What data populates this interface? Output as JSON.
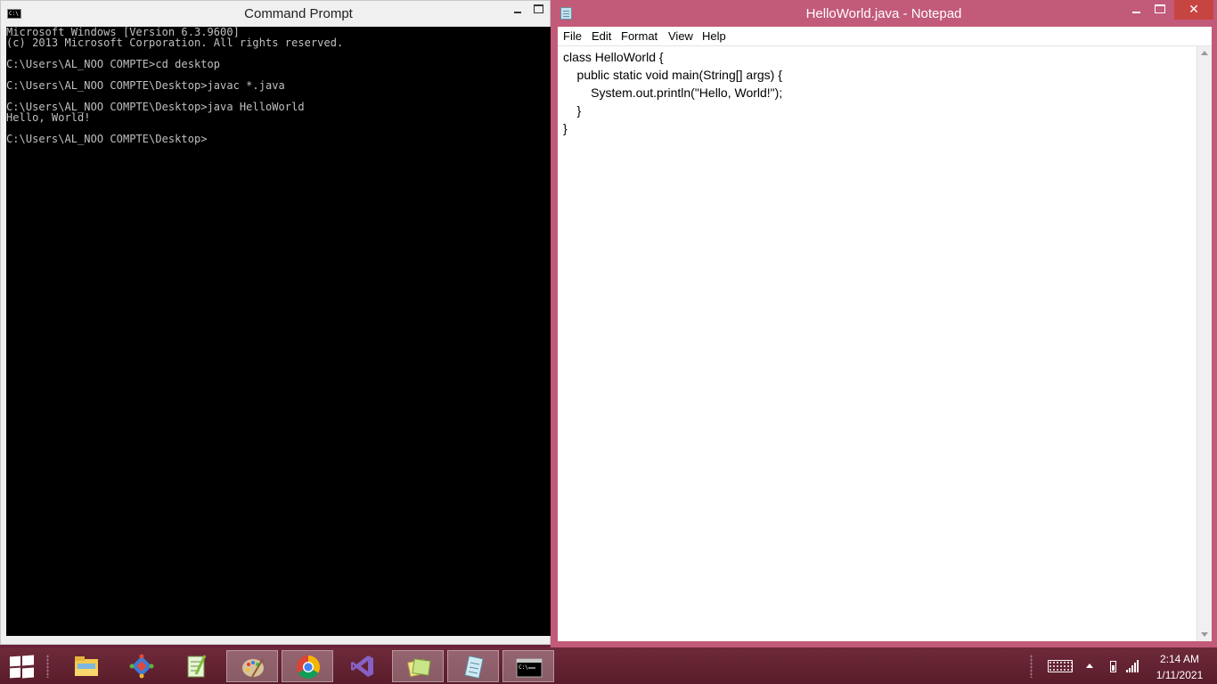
{
  "cmd": {
    "title": "Command Prompt",
    "lines": [
      "Microsoft Windows [Version 6.3.9600]",
      "(c) 2013 Microsoft Corporation. All rights reserved.",
      "",
      "C:\\Users\\AL_NOO COMPTE>cd desktop",
      "",
      "C:\\Users\\AL_NOO COMPTE\\Desktop>javac *.java",
      "",
      "C:\\Users\\AL_NOO COMPTE\\Desktop>java HelloWorld",
      "Hello, World!",
      "",
      "C:\\Users\\AL_NOO COMPTE\\Desktop>"
    ]
  },
  "notepad": {
    "title": "HelloWorld.java - Notepad",
    "close_label": "✕",
    "menu": [
      "File",
      "Edit",
      "Format",
      "View",
      "Help"
    ],
    "code_lines": [
      "class HelloWorld {",
      "    public static void main(String[] args) {",
      "        System.out.println(\"Hello, World!\");",
      "    }",
      "}"
    ]
  },
  "taskbar": {
    "apps": [
      {
        "name": "file-explorer",
        "icon": "folder-icon",
        "active": false
      },
      {
        "name": "git",
        "icon": "git-icon",
        "active": false
      },
      {
        "name": "notepad-plus-plus",
        "icon": "notepadpp-icon",
        "active": false
      },
      {
        "name": "paint",
        "icon": "palette-icon",
        "active": true
      },
      {
        "name": "chrome",
        "icon": "chrome-icon",
        "active": true
      },
      {
        "name": "visual-studio",
        "icon": "visual-studio-icon",
        "active": false
      },
      {
        "name": "sticky-notes",
        "icon": "sticky-notes-icon",
        "active": true
      },
      {
        "name": "notepad",
        "icon": "notepad-icon",
        "active": true
      },
      {
        "name": "command-prompt",
        "icon": "cmd-icon",
        "active": true
      }
    ],
    "clock_time": "2:14 AM",
    "clock_date": "1/11/2021"
  },
  "colors": {
    "desktop": "#6b1f3a",
    "notepad_frame": "#c25a79",
    "close_button": "#c74541"
  }
}
